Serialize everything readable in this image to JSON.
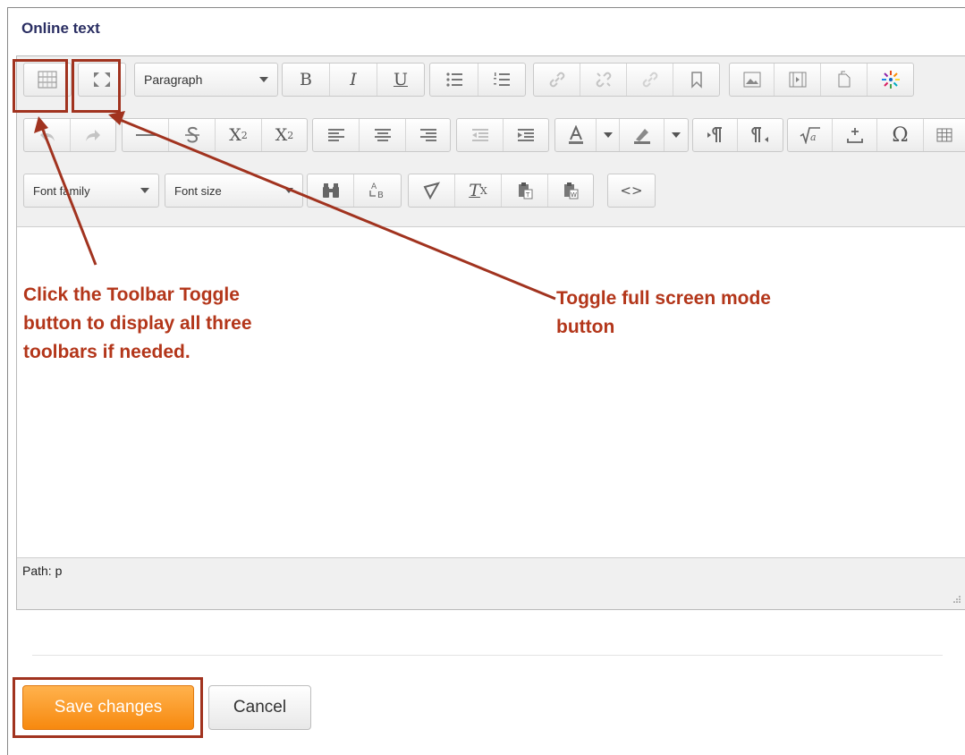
{
  "form": {
    "title": "Online text",
    "save_label": "Save changes",
    "cancel_label": "Cancel"
  },
  "toolbar": {
    "row1": {
      "toolbar_toggle_icon": "toolbar-toggle-icon",
      "fullscreen_icon": "fullscreen-icon",
      "format_select": "Paragraph",
      "bold": "B",
      "italic": "I",
      "underline": "U"
    },
    "row2": {
      "subscript": "X",
      "subscript_sub": "2",
      "superscript": "X",
      "superscript_sup": "2",
      "omega": "Ω"
    },
    "row3": {
      "font_family": "Font family",
      "font_size": "Font size",
      "clear_format": "T",
      "clear_format_sub": "X",
      "code": "<>"
    }
  },
  "statusbar": {
    "path": "Path: p"
  },
  "annotations": {
    "toolbar_toggle_note": "Click the Toolbar Toggle\nbutton to display all three\ntoolbars if needed.",
    "fullscreen_note": "Toggle full screen mode\nbutton",
    "highlight_color": "#a1331f",
    "text_color": "#b3361a"
  },
  "colors": {
    "title": "#2b2f63",
    "save_button": "#f7890f"
  }
}
